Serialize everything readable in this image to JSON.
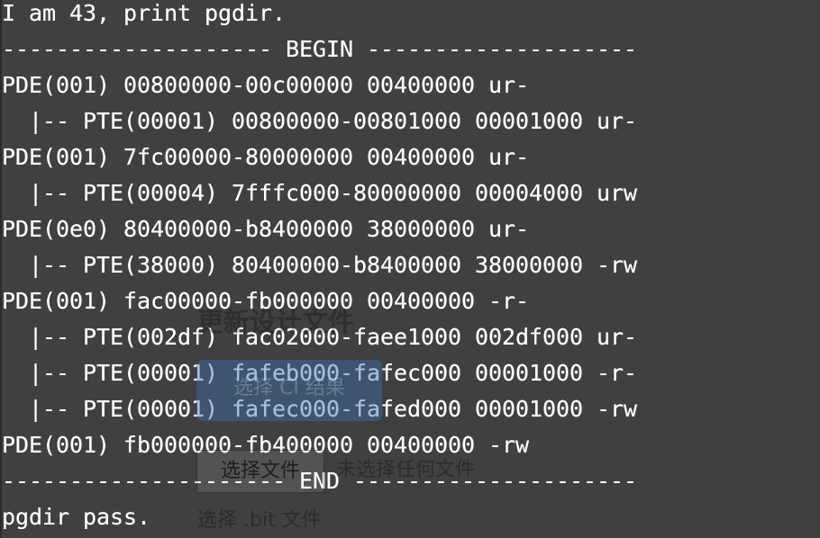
{
  "terminal": {
    "lines": [
      "I am 43, print pgdir.",
      "-------------------- BEGIN --------------------",
      "PDE(001) 00800000-00c00000 00400000 ur-",
      "  |-- PTE(00001) 00800000-00801000 00001000 ur-",
      "PDE(001) 7fc00000-80000000 00400000 ur-",
      "  |-- PTE(00004) 7fffc000-80000000 00004000 urw",
      "PDE(0e0) 80400000-b8400000 38000000 ur-",
      "  |-- PTE(38000) 80400000-b8400000 38000000 -rw",
      "PDE(001) fac00000-fb000000 00400000 -r-",
      "  |-- PTE(002df) fac02000-faee1000 002df000 ur-",
      "  |-- PTE(00001) fafeb000-fafec000 00001000 -r-",
      "  |-- PTE(00001) fafec000-fafed000 00001000 -rw",
      "PDE(001) fb000000-fb400000 00400000 -rw",
      "--------------------- END ---------------------",
      "pgdir pass."
    ]
  },
  "overlay": {
    "title": "更新设计文件",
    "ci_button_label": "选择 CI 结果",
    "file_button_label": "选择文件",
    "no_file_text": "未选择任何文件",
    "hint_text": "选择 .bit 文件"
  },
  "colors": {
    "terminal_bg": "#404040",
    "terminal_text": "#ffffff",
    "ci_button_bg": "#3c6eaa"
  }
}
